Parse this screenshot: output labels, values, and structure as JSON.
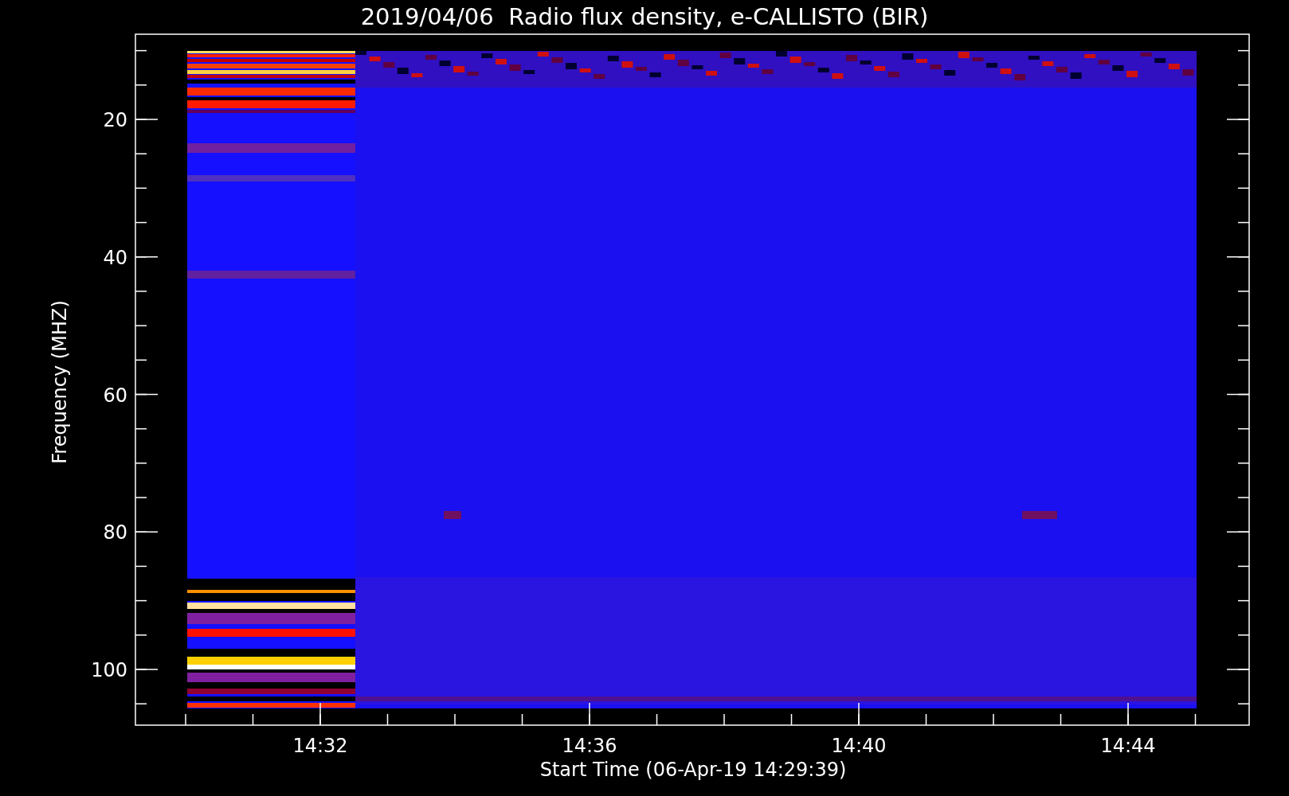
{
  "title": "2019/04/06  Radio flux density, e-CALLISTO (BIR)",
  "y_axis": {
    "label": "Frequency (MHZ)",
    "ticks": [
      "20",
      "40",
      "60",
      "80",
      "100"
    ]
  },
  "x_axis": {
    "label": "Start Time (06-Apr-19 14:29:39)",
    "ticks": [
      "14:32",
      "14:36",
      "14:40",
      "14:44"
    ]
  }
}
